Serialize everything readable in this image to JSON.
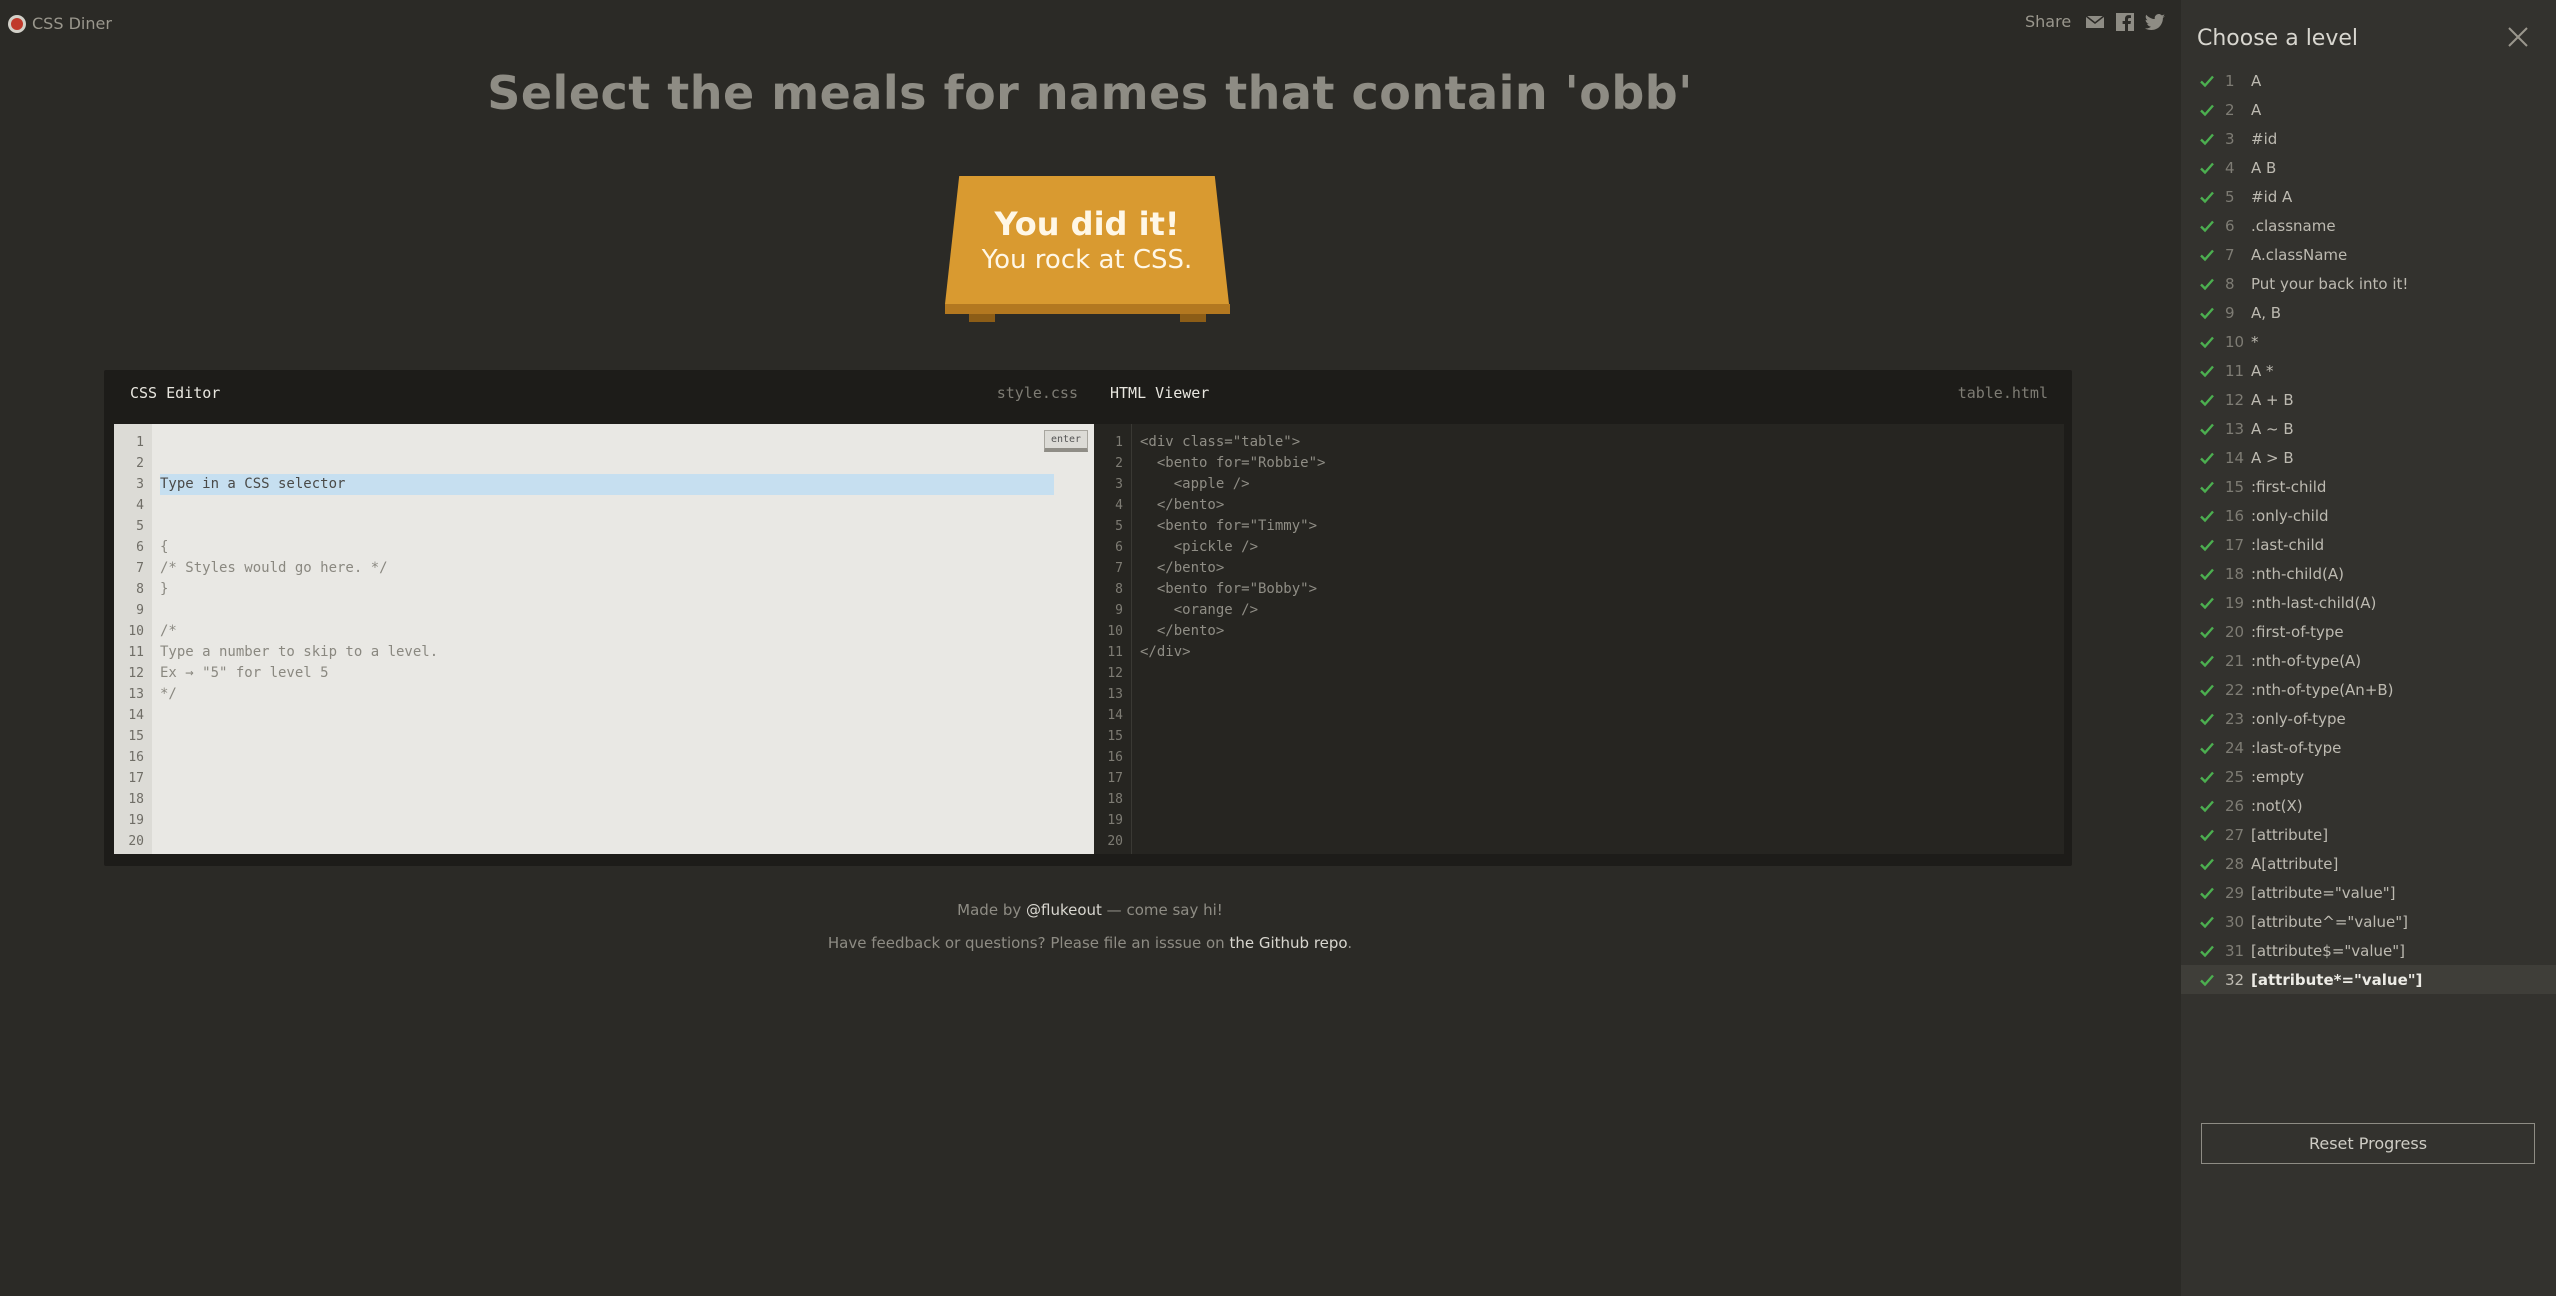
{
  "app": {
    "title": "CSS Diner"
  },
  "share": {
    "label": "Share"
  },
  "instruction": "Select the meals for names that contain 'obb'",
  "plate": {
    "title": "You did it!",
    "subtitle": "You rock at CSS."
  },
  "css_editor": {
    "title": "CSS Editor",
    "file": "style.css",
    "input_placeholder": "Type in a CSS selector",
    "enter_label": "enter",
    "lines": [
      "{",
      "/* Styles would go here. */",
      "}",
      "",
      "/*",
      "Type a number to skip to a level.",
      "Ex → \"5\" for level 5",
      "*/"
    ],
    "line_numbers": [
      "1",
      "2",
      "3",
      "4",
      "5",
      "6",
      "7",
      "8",
      "9",
      "10",
      "11",
      "12",
      "13",
      "14",
      "15",
      "16",
      "17",
      "18",
      "19",
      "20"
    ]
  },
  "html_viewer": {
    "title": "HTML Viewer",
    "file": "table.html",
    "lines": [
      "<div class=\"table\">",
      "  <bento for=\"Robbie\">",
      "    <apple />",
      "  </bento>",
      "  <bento for=\"Timmy\">",
      "    <pickle />",
      "  </bento>",
      "  <bento for=\"Bobby\">",
      "    <orange />",
      "  </bento>",
      "</div>"
    ],
    "line_numbers": [
      "1",
      "2",
      "3",
      "4",
      "5",
      "6",
      "7",
      "8",
      "9",
      "10",
      "11",
      "12",
      "13",
      "14",
      "15",
      "16",
      "17",
      "18",
      "19",
      "20"
    ]
  },
  "footer": {
    "made_by_prefix": "Made by ",
    "made_by_link": "@flukeout",
    "made_by_suffix": " — come say hi!",
    "feedback_prefix": "Have feedback or questions? Please file an isssue on ",
    "feedback_link": "the Github repo",
    "feedback_suffix": "."
  },
  "sidebar": {
    "title": "Choose a level",
    "reset_label": "Reset Progress",
    "check_color": "#4caf50",
    "levels": [
      {
        "num": "1",
        "name": "A"
      },
      {
        "num": "2",
        "name": "A"
      },
      {
        "num": "3",
        "name": "#id"
      },
      {
        "num": "4",
        "name": "A B"
      },
      {
        "num": "5",
        "name": "#id A"
      },
      {
        "num": "6",
        "name": ".classname"
      },
      {
        "num": "7",
        "name": "A.className"
      },
      {
        "num": "8",
        "name": "Put your back into it!"
      },
      {
        "num": "9",
        "name": "A, B"
      },
      {
        "num": "10",
        "name": "*"
      },
      {
        "num": "11",
        "name": "A *"
      },
      {
        "num": "12",
        "name": "A + B"
      },
      {
        "num": "13",
        "name": "A ~ B"
      },
      {
        "num": "14",
        "name": "A > B"
      },
      {
        "num": "15",
        "name": ":first-child"
      },
      {
        "num": "16",
        "name": ":only-child"
      },
      {
        "num": "17",
        "name": ":last-child"
      },
      {
        "num": "18",
        "name": ":nth-child(A)"
      },
      {
        "num": "19",
        "name": ":nth-last-child(A)"
      },
      {
        "num": "20",
        "name": ":first-of-type"
      },
      {
        "num": "21",
        "name": ":nth-of-type(A)"
      },
      {
        "num": "22",
        "name": ":nth-of-type(An+B)"
      },
      {
        "num": "23",
        "name": ":only-of-type"
      },
      {
        "num": "24",
        "name": ":last-of-type"
      },
      {
        "num": "25",
        "name": ":empty"
      },
      {
        "num": "26",
        "name": ":not(X)"
      },
      {
        "num": "27",
        "name": "[attribute]"
      },
      {
        "num": "28",
        "name": "A[attribute]"
      },
      {
        "num": "29",
        "name": "[attribute=\"value\"]"
      },
      {
        "num": "30",
        "name": "[attribute^=\"value\"]"
      },
      {
        "num": "31",
        "name": "[attribute$=\"value\"]"
      },
      {
        "num": "32",
        "name": "[attribute*=\"value\"]",
        "active": true
      }
    ]
  }
}
